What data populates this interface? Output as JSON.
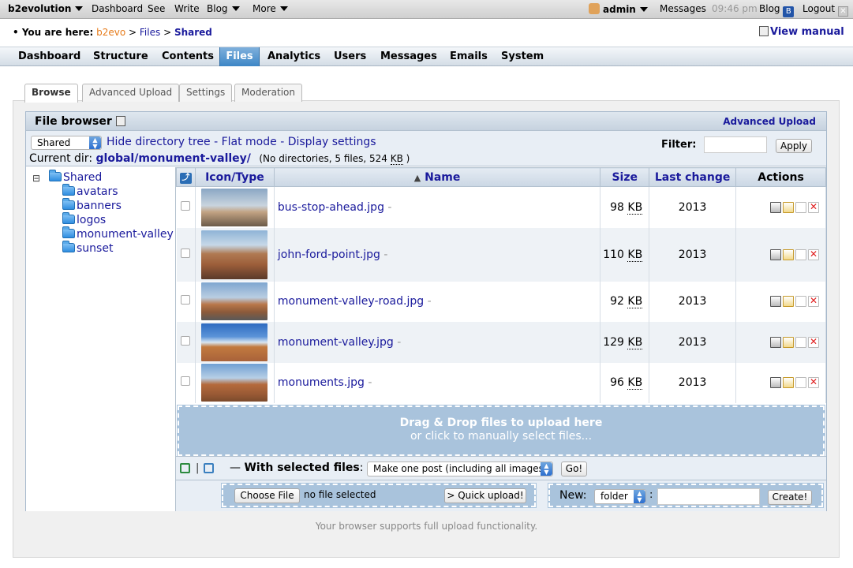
{
  "topbar": {
    "brand": "b2evolution",
    "items": [
      "Dashboard",
      "See",
      "Write",
      "Blog",
      "More"
    ],
    "user": "admin",
    "messages": "Messages",
    "time": "09:46 pm",
    "blog": "Blog",
    "logout": "Logout"
  },
  "breadcrumb": {
    "prefix": "• You are here:",
    "items": [
      "b2evo",
      "Files",
      "Shared"
    ],
    "sep": ">",
    "manual": "View manual"
  },
  "menu": [
    "Dashboard",
    "Structure",
    "Contents",
    "Files",
    "Analytics",
    "Users",
    "Messages",
    "Emails",
    "System"
  ],
  "tabs": [
    "Browse",
    "Advanced Upload",
    "Settings",
    "Moderation"
  ],
  "filebrowser": {
    "title": "File browser",
    "advanced_upload": "Advanced Upload",
    "root_select": "Shared",
    "links": [
      "Hide directory tree",
      "Flat mode",
      "Display settings"
    ],
    "current_dir_label": "Current dir:",
    "current_dir": "global/monument-valley/",
    "dir_info_pre": "(No directories, 5 files, 524",
    "dir_info_unit": "KB",
    "dir_info_post": ")",
    "filter_label": "Filter:",
    "filter_value": "",
    "apply": "Apply"
  },
  "tree": {
    "root": "Shared",
    "toggle": "⊟",
    "children": [
      "avatars",
      "banners",
      "logos",
      "monument-valley",
      "sunset"
    ]
  },
  "table": {
    "headers": {
      "icon": "Icon/Type",
      "name": "Name",
      "size": "Size",
      "change": "Last change",
      "actions": "Actions"
    },
    "rows": [
      {
        "name": "bus-stop-ahead.jpg",
        "size": "98",
        "unit": "KB",
        "year": "2013"
      },
      {
        "name": "john-ford-point.jpg",
        "size": "110",
        "unit": "KB",
        "year": "2013"
      },
      {
        "name": "monument-valley-road.jpg",
        "size": "92",
        "unit": "KB",
        "year": "2013"
      },
      {
        "name": "monument-valley.jpg",
        "size": "129",
        "unit": "KB",
        "year": "2013"
      },
      {
        "name": "monuments.jpg",
        "size": "96",
        "unit": "KB",
        "year": "2013"
      }
    ],
    "dash": "-"
  },
  "dropzone": {
    "line1": "Drag & Drop files to upload here",
    "line2": "or click to manually select files..."
  },
  "bulk": {
    "label": "With selected files",
    "dash": "—",
    "colon": ":",
    "action": "Make one post (including all images)",
    "go": "Go!"
  },
  "upload": {
    "choose": "Choose File",
    "none": "no file selected",
    "quick": "> Quick upload!",
    "new_label": "New:",
    "new_type": "folder",
    "new_value": "",
    "create": "Create!"
  },
  "footer": "Your browser supports full upload functionality."
}
